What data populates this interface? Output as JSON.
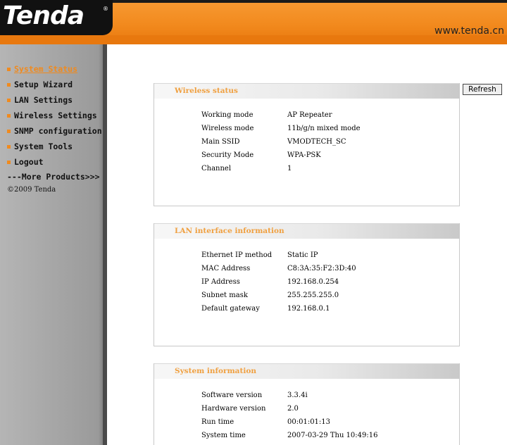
{
  "header": {
    "logo": "Tenda",
    "logo_mark": "®",
    "site_url": "www.tenda.cn"
  },
  "sidebar": {
    "items": [
      {
        "label": "System Status",
        "active": true
      },
      {
        "label": "Setup Wizard"
      },
      {
        "label": "LAN Settings"
      },
      {
        "label": "Wireless Settings"
      },
      {
        "label": "SNMP configuration"
      },
      {
        "label": "System Tools"
      },
      {
        "label": "Logout"
      }
    ],
    "more_link": "---More Products>>>",
    "copyright": "©2009 Tenda"
  },
  "main": {
    "refresh_label": "Refresh",
    "wireless": {
      "title": "Wireless status",
      "rows": [
        {
          "k": "Working mode",
          "v": "AP Repeater"
        },
        {
          "k": "Wireless mode",
          "v": "11b/g/n mixed mode"
        },
        {
          "k": "Main SSID",
          "v": "VMODTECH_SC"
        },
        {
          "k": "Security Mode",
          "v": "WPA-PSK"
        },
        {
          "k": "Channel",
          "v": "1"
        }
      ]
    },
    "lan": {
      "title": "LAN interface information",
      "rows": [
        {
          "k": "Ethernet IP method",
          "v": "Static IP"
        },
        {
          "k": "MAC Address",
          "v": "C8:3A:35:F2:3D:40"
        },
        {
          "k": "IP Address",
          "v": "192.168.0.254"
        },
        {
          "k": "Subnet mask",
          "v": "255.255.255.0"
        },
        {
          "k": "Default gateway",
          "v": "192.168.0.1"
        }
      ]
    },
    "system": {
      "title": "System information",
      "rows": [
        {
          "k": "Software version",
          "v": "3.3.4i"
        },
        {
          "k": "Hardware version",
          "v": "2.0"
        },
        {
          "k": "Run time",
          "v": "00:01:01:13"
        },
        {
          "k": "System time",
          "v": "2007-03-29 Thu 10:49:16"
        }
      ]
    }
  },
  "colors": {
    "header_orange": "#f28a1e",
    "accent_orange": "#f0a040",
    "sidebar_gray": "#a8a8a8"
  }
}
